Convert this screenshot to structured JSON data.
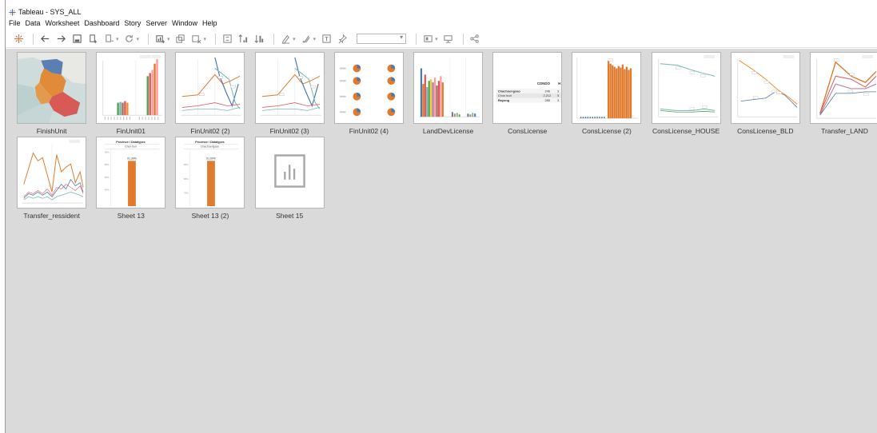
{
  "window": {
    "title": "Tableau - SYS_ALL"
  },
  "menu": [
    "File",
    "Data",
    "Worksheet",
    "Dashboard",
    "Story",
    "Server",
    "Window",
    "Help"
  ],
  "toolbar": {
    "icons": [
      "tableau-logo-icon",
      "undo-icon",
      "redo-icon",
      "save-icon",
      "new-datasource-icon",
      "pause-updates-icon",
      "refresh-icon",
      "new-worksheet-icon",
      "duplicate-icon",
      "clear-sheet-icon",
      "swap-icon",
      "sort-ascending-icon",
      "sort-descending-icon",
      "highlight-icon",
      "group-icon",
      "show-labels-icon",
      "pin-icon",
      "fit-dropdown",
      "show-cards-icon",
      "presentation-icon",
      "share-icon"
    ]
  },
  "colors": {
    "orange": "#e07b2e",
    "teal": "#76b7b2",
    "blue": "#4e79a7",
    "red": "#e15759",
    "green": "#59a14f",
    "gray_bg": "#dadada"
  },
  "sheets": [
    {
      "name": "FinishUnit",
      "thumb": "map"
    },
    {
      "name": "FinUnit01",
      "thumb": "bars"
    },
    {
      "name": "FinUnit02 (2)",
      "thumb": "lines"
    },
    {
      "name": "FinUnit02 (3)",
      "thumb": "lines"
    },
    {
      "name": "FinUnit02 (4)",
      "thumb": "pies"
    },
    {
      "name": "LandDevLicense",
      "thumb": "multibars"
    },
    {
      "name": "ConsLicense",
      "thumb": "table"
    },
    {
      "name": "ConsLicense (2)",
      "thumb": "orangebars"
    },
    {
      "name": "ConsLicense_HOUSE",
      "thumb": "twolines"
    },
    {
      "name": "ConsLicense_BLD",
      "thumb": "declines"
    },
    {
      "name": "Transfer_LAND",
      "thumb": "zigzag"
    },
    {
      "name": "Transfer_ressident",
      "thumb": "spiky"
    },
    {
      "name": "Sheet 13",
      "thumb": "singlebar"
    },
    {
      "name": "Sheet 13 (2)",
      "thumb": "singlebar2"
    },
    {
      "name": "Sheet 15",
      "thumb": "empty"
    }
  ],
  "thumb_text": {
    "table": {
      "header": "CONDO",
      "header2": "H",
      "rows": [
        {
          "name": "Chachoengsao",
          "value": "246",
          "v2": "3"
        },
        {
          "name": "Chon buri",
          "value": "2,212",
          "v2": "5"
        },
        {
          "name": "Rayong",
          "value": "285",
          "v2": "3"
        }
      ]
    },
    "sheet13": {
      "title": "Province / Datatypes",
      "sub": "Chon buri",
      "label": "91.39%"
    },
    "sheet13b": {
      "title": "Province / Datatypes",
      "sub": "Chachoengsao",
      "label": "91.00%"
    }
  }
}
